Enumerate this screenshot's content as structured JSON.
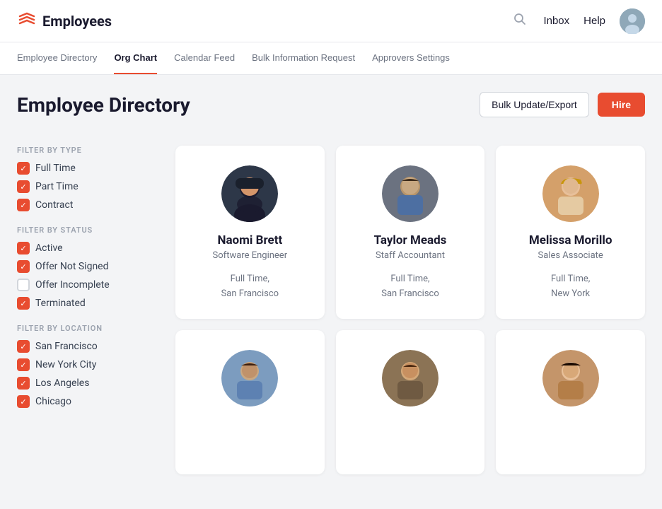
{
  "app": {
    "logo_text": "Employees",
    "logo_icon": "≡"
  },
  "header": {
    "inbox_label": "Inbox",
    "help_label": "Help"
  },
  "nav": {
    "tabs": [
      {
        "id": "employee-directory",
        "label": "Employee Directory",
        "active": false
      },
      {
        "id": "org-chart",
        "label": "Org Chart",
        "active": true
      },
      {
        "id": "calendar-feed",
        "label": "Calendar Feed",
        "active": false
      },
      {
        "id": "bulk-information-request",
        "label": "Bulk Information Request",
        "active": false
      },
      {
        "id": "approvers-settings",
        "label": "Approvers Settings",
        "active": false
      }
    ]
  },
  "page": {
    "title": "Employee Directory",
    "bulk_update_label": "Bulk Update/Export",
    "hire_label": "Hire"
  },
  "filters": {
    "type_section_title": "FILTER BY TYPE",
    "type_filters": [
      {
        "id": "full-time",
        "label": "Full Time",
        "checked": true
      },
      {
        "id": "part-time",
        "label": "Part Time",
        "checked": true
      },
      {
        "id": "contract",
        "label": "Contract",
        "checked": true
      }
    ],
    "status_section_title": "FILTER BY STATUS",
    "status_filters": [
      {
        "id": "active",
        "label": "Active",
        "checked": true
      },
      {
        "id": "offer-not-signed",
        "label": "Offer Not Signed",
        "checked": true
      },
      {
        "id": "offer-incomplete",
        "label": "Offer Incomplete",
        "checked": false
      },
      {
        "id": "terminated",
        "label": "Terminated",
        "checked": true
      }
    ],
    "location_section_title": "FILTER BY LOCATION",
    "location_filters": [
      {
        "id": "san-francisco",
        "label": "San Francisco",
        "checked": true
      },
      {
        "id": "new-york-city",
        "label": "New York City",
        "checked": true
      },
      {
        "id": "los-angeles",
        "label": "Los Angeles",
        "checked": true
      },
      {
        "id": "chicago",
        "label": "Chicago",
        "checked": true
      }
    ]
  },
  "employees": [
    {
      "id": "naomi-brett",
      "name": "Naomi Brett",
      "role": "Software Engineer",
      "employment_type": "Full Time,",
      "location": "San Francisco",
      "avatar_style": "naomi"
    },
    {
      "id": "taylor-meads",
      "name": "Taylor Meads",
      "role": "Staff Accountant",
      "employment_type": "Full Time,",
      "location": "San Francisco",
      "avatar_style": "taylor"
    },
    {
      "id": "melissa-morillo",
      "name": "Melissa Morillo",
      "role": "Sales Associate",
      "employment_type": "Full Time,",
      "location": "New York",
      "avatar_style": "melissa"
    },
    {
      "id": "employee-4",
      "name": "",
      "role": "",
      "employment_type": "",
      "location": "",
      "avatar_style": "row2a"
    },
    {
      "id": "employee-5",
      "name": "",
      "role": "",
      "employment_type": "",
      "location": "",
      "avatar_style": "row2b"
    },
    {
      "id": "employee-6",
      "name": "",
      "role": "",
      "employment_type": "",
      "location": "",
      "avatar_style": "row2c"
    }
  ]
}
